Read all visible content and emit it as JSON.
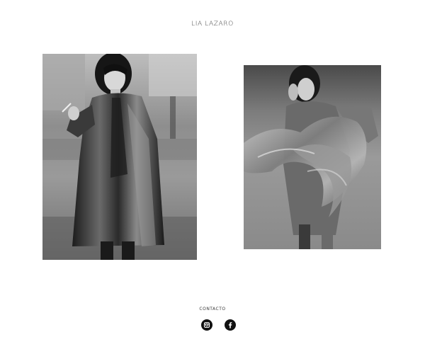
{
  "header": {
    "brand": "LIA LAZARO"
  },
  "gallery": {
    "photos": [
      {
        "description": "Black and white fashion photo: model in glossy trench coat holding a cigarette on a street"
      },
      {
        "description": "Black and white fashion photo: model dancing with flowing sheer fabric"
      }
    ]
  },
  "footer": {
    "contact_label": "CONTACTO",
    "social": [
      {
        "icon": "instagram-icon"
      },
      {
        "icon": "facebook-icon"
      }
    ]
  }
}
